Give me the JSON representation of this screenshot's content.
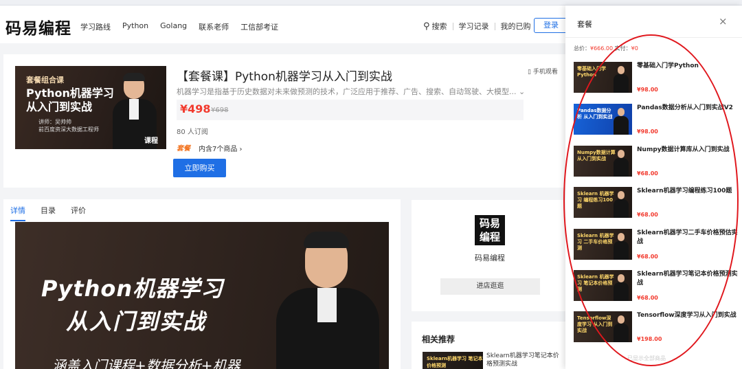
{
  "header": {
    "logo": "码易编程",
    "nav": [
      "学习路线",
      "Python",
      "Golang",
      "联系老师",
      "工信部考证"
    ],
    "search_label": "搜索",
    "links": [
      "学习记录",
      "我的已购"
    ],
    "login_label": "登录"
  },
  "product": {
    "cover": {
      "tag": "套餐组合课",
      "title_line1": "Python机器学习",
      "title_line2": "从入门到实战",
      "lecturer": "讲师：吴帅帅",
      "lecturer_title": "前百度资深大数据工程师",
      "badge": "课程"
    },
    "title": "【套餐课】Python机器学习从入门到实战",
    "description": "机器学习是指基于历史数据对未来做预测的技术，广泛应用于推荐、广告、搜索、自动驾驶、大模型...",
    "price": "¥498",
    "original_price": "¥698",
    "subscribers": "80 人订阅",
    "bundle_tag": "套餐",
    "bundle_link": "内含7个商品 ›",
    "buy_label": "立即购买",
    "mobile_view": "手机观看"
  },
  "detail": {
    "tabs": [
      "详情",
      "目录",
      "评价"
    ],
    "hero_line1": "Python机器学习",
    "hero_line2": "从入门到实战",
    "hero_line3": "涵盖入门课程+数据分析+机器"
  },
  "shop": {
    "logo_line1": "码易",
    "logo_line2": "编程",
    "name": "码易编程",
    "enter_label": "进店逛逛"
  },
  "recommend": {
    "title": "相关推荐",
    "thumb_text": "Sklearn机器学习 笔记本价格预测",
    "item_title": "Sklearn机器学习笔记本价格预测实战"
  },
  "drawer": {
    "title": "套餐",
    "close_icon": "close-icon",
    "total_label": "总价：",
    "total_value": "¥666.00",
    "paid_label": "实付：",
    "paid_value": "¥0",
    "items": [
      {
        "thumb": "零基础入门学 Python",
        "name": "零基础入门学Python",
        "price": "¥98.00",
        "blue": false
      },
      {
        "thumb": "Pandas数据分析 从入门到实战",
        "name": "Pandas数据分析从入门到实战V2",
        "price": "¥98.00",
        "blue": true
      },
      {
        "thumb": "Numpy数据计算 从入门到实战",
        "name": "Numpy数据计算库从入门到实战",
        "price": "¥68.00",
        "blue": false
      },
      {
        "thumb": "Sklearn 机器学习 编程练习100题",
        "name": "Sklearn机器学习编程练习100题",
        "price": "¥68.00",
        "blue": false
      },
      {
        "thumb": "Sklearn 机器学习 二手车价格预测",
        "name": "Sklearn机器学习二手车价格预估实战",
        "price": "¥68.00",
        "blue": false
      },
      {
        "thumb": "Sklearn 机器学习 笔记本价格预测",
        "name": "Sklearn机器学习笔记本价格预测实战",
        "price": "¥68.00",
        "blue": false
      },
      {
        "thumb": "Tensorflow深度学习 从入门到实战",
        "name": "Tensorflow深度学习从入门到实战",
        "price": "¥198.00",
        "blue": false
      }
    ],
    "footnote": "已显示全部商品"
  },
  "colors": {
    "accent": "#1f6fe5",
    "price": "#f23a2e",
    "annotation": "#e0171d"
  }
}
